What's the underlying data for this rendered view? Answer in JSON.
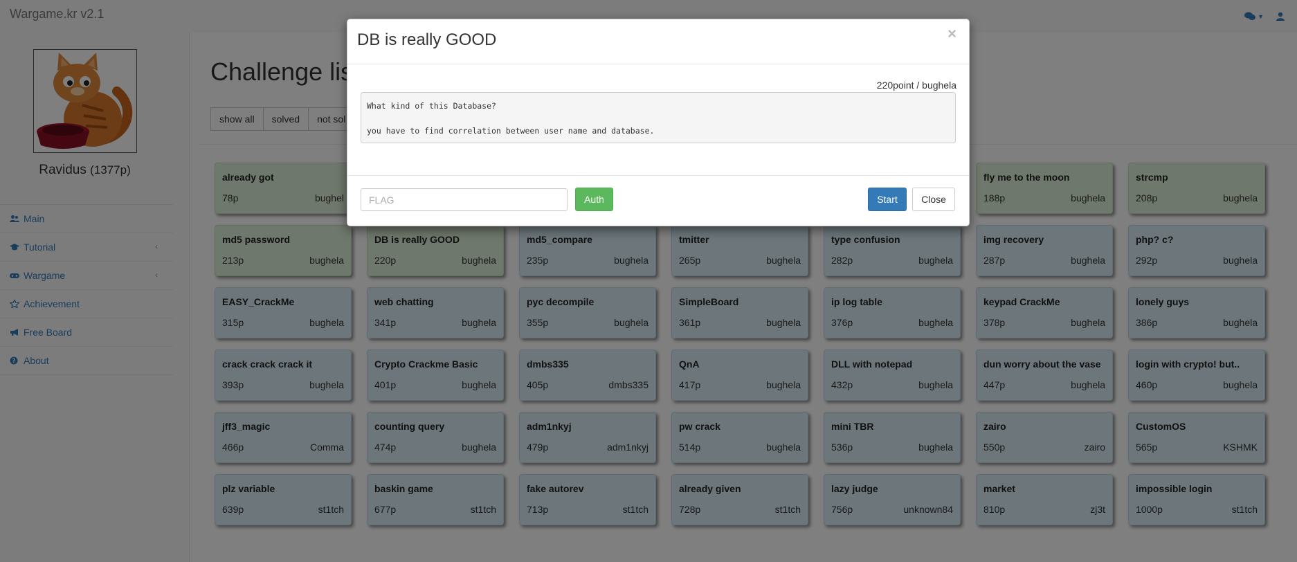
{
  "navbar": {
    "brand": "Wargame.kr v2.1",
    "icons": [
      "comments-icon",
      "user-icon"
    ]
  },
  "sidebar": {
    "username": "Ravidus",
    "points": "(1377p)",
    "menu": [
      {
        "label": "Main",
        "icon": "users-icon",
        "has_submenu": false
      },
      {
        "label": "Tutorial",
        "icon": "graduation-cap-icon",
        "has_submenu": true
      },
      {
        "label": "Wargame",
        "icon": "gamepad-icon",
        "has_submenu": true
      },
      {
        "label": "Achievement",
        "icon": "star-icon",
        "has_submenu": false
      },
      {
        "label": "Free Board",
        "icon": "bullhorn-icon",
        "has_submenu": false
      },
      {
        "label": "About",
        "icon": "question-circle-icon",
        "has_submenu": false
      }
    ]
  },
  "main": {
    "title": "Challenge lis",
    "filters": [
      "show all",
      "solved",
      "not sol"
    ]
  },
  "challenges": [
    [
      {
        "name": "already got",
        "points": "78p",
        "author": "bughel",
        "solved": true
      },
      {
        "name": "",
        "points": "",
        "author": "",
        "solved": true
      },
      {
        "name": "",
        "points": "",
        "author": "",
        "solved": true
      },
      {
        "name": "",
        "points": "",
        "author": "",
        "solved": true
      },
      {
        "name": "",
        "points": "",
        "author": "",
        "solved": true
      },
      {
        "name": "fly me to the moon",
        "points": "188p",
        "author": "bughela",
        "solved": true
      },
      {
        "name": "strcmp",
        "points": "208p",
        "author": "bughela",
        "solved": true
      }
    ],
    [
      {
        "name": "md5 password",
        "points": "213p",
        "author": "bughela",
        "solved": true
      },
      {
        "name": "DB is really GOOD",
        "points": "220p",
        "author": "bughela",
        "solved": true
      },
      {
        "name": "md5_compare",
        "points": "235p",
        "author": "bughela",
        "solved": false
      },
      {
        "name": "tmitter",
        "points": "265p",
        "author": "bughela",
        "solved": false
      },
      {
        "name": "type confusion",
        "points": "282p",
        "author": "bughela",
        "solved": false
      },
      {
        "name": "img recovery",
        "points": "287p",
        "author": "bughela",
        "solved": false
      },
      {
        "name": "php? c?",
        "points": "292p",
        "author": "bughela",
        "solved": false
      }
    ],
    [
      {
        "name": "EASY_CrackMe",
        "points": "315p",
        "author": "bughela",
        "solved": false
      },
      {
        "name": "web chatting",
        "points": "341p",
        "author": "bughela",
        "solved": false
      },
      {
        "name": "pyc decompile",
        "points": "355p",
        "author": "bughela",
        "solved": false
      },
      {
        "name": "SimpleBoard",
        "points": "361p",
        "author": "bughela",
        "solved": false
      },
      {
        "name": "ip log table",
        "points": "376p",
        "author": "bughela",
        "solved": false
      },
      {
        "name": "keypad CrackMe",
        "points": "378p",
        "author": "bughela",
        "solved": false
      },
      {
        "name": "lonely guys",
        "points": "386p",
        "author": "bughela",
        "solved": false
      }
    ],
    [
      {
        "name": "crack crack crack it",
        "points": "393p",
        "author": "bughela",
        "solved": false
      },
      {
        "name": "Crypto Crackme Basic",
        "points": "401p",
        "author": "bughela",
        "solved": false
      },
      {
        "name": "dmbs335",
        "points": "405p",
        "author": "dmbs335",
        "solved": false
      },
      {
        "name": "QnA",
        "points": "417p",
        "author": "bughela",
        "solved": false
      },
      {
        "name": "DLL with notepad",
        "points": "432p",
        "author": "bughela",
        "solved": false
      },
      {
        "name": "dun worry about the vase",
        "points": "447p",
        "author": "bughela",
        "solved": false
      },
      {
        "name": "login with crypto! but..",
        "points": "460p",
        "author": "bughela",
        "solved": false
      }
    ],
    [
      {
        "name": "jff3_magic",
        "points": "466p",
        "author": "Comma",
        "solved": false
      },
      {
        "name": "counting query",
        "points": "474p",
        "author": "bughela",
        "solved": false
      },
      {
        "name": "adm1nkyj",
        "points": "479p",
        "author": "adm1nkyj",
        "solved": false
      },
      {
        "name": "pw crack",
        "points": "514p",
        "author": "bughela",
        "solved": false
      },
      {
        "name": "mini TBR",
        "points": "536p",
        "author": "bughela",
        "solved": false
      },
      {
        "name": "zairo",
        "points": "550p",
        "author": "zairo",
        "solved": false
      },
      {
        "name": "CustomOS",
        "points": "565p",
        "author": "KSHMK",
        "solved": false
      }
    ],
    [
      {
        "name": "plz variable",
        "points": "639p",
        "author": "st1tch",
        "solved": false
      },
      {
        "name": "baskin game",
        "points": "677p",
        "author": "st1tch",
        "solved": false
      },
      {
        "name": "fake autorev",
        "points": "713p",
        "author": "st1tch",
        "solved": false
      },
      {
        "name": "already given",
        "points": "728p",
        "author": "st1tch",
        "solved": false
      },
      {
        "name": "lazy judge",
        "points": "756p",
        "author": "unknown84",
        "solved": false
      },
      {
        "name": "market",
        "points": "810p",
        "author": "zj3t",
        "solved": false
      },
      {
        "name": "impossible login",
        "points": "1000p",
        "author": "st1tch",
        "solved": false
      }
    ]
  ],
  "modal": {
    "title": "DB is really GOOD",
    "close_symbol": "×",
    "meta": "220point / bughela",
    "description": [
      "What kind of this Database?",
      "you have to find correlation between user name and database."
    ],
    "flag_placeholder": "FLAG",
    "auth_label": "Auth",
    "start_label": "Start",
    "close_label": "Close"
  }
}
